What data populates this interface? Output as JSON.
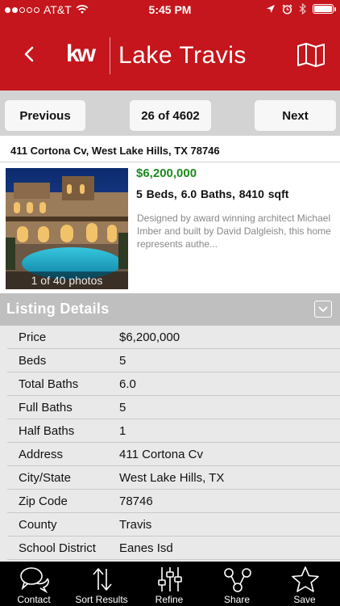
{
  "status_bar": {
    "carrier": "AT&T",
    "time": "5:45 PM"
  },
  "nav": {
    "logo": "kw",
    "title": "Lake Travis"
  },
  "pager": {
    "previous_label": "Previous",
    "position": "26 of 4602",
    "next_label": "Next"
  },
  "listing": {
    "address": "411 Cortona Cv, West Lake Hills, TX 78746",
    "price": "$6,200,000",
    "specs": "5 Beds,  6.0 Baths,  8410 sqft",
    "description": "Designed by award winning architect Michael Imber and built by David Dalgleish, this home represents authe...",
    "photo_caption": "1 of 40 photos"
  },
  "details": {
    "header": "Listing Details",
    "rows": [
      {
        "label": "Price",
        "value": "$6,200,000"
      },
      {
        "label": "Beds",
        "value": "5"
      },
      {
        "label": "Total Baths",
        "value": "6.0"
      },
      {
        "label": "Full Baths",
        "value": "5"
      },
      {
        "label": "Half Baths",
        "value": "1"
      },
      {
        "label": "Address",
        "value": "411 Cortona Cv"
      },
      {
        "label": "City/State",
        "value": "West Lake Hills, TX"
      },
      {
        "label": "Zip Code",
        "value": "78746"
      },
      {
        "label": "County",
        "value": "Travis"
      },
      {
        "label": "School District",
        "value": "Eanes Isd"
      }
    ]
  },
  "tabs": [
    {
      "label": "Contact",
      "icon": "chat-bubbles-icon"
    },
    {
      "label": "Sort Results",
      "icon": "sort-arrows-icon"
    },
    {
      "label": "Refine",
      "icon": "sliders-icon"
    },
    {
      "label": "Share",
      "icon": "share-icon"
    },
    {
      "label": "Save",
      "icon": "star-icon"
    }
  ],
  "colors": {
    "brand_red": "#c4161c",
    "price_green": "#1d8a1d",
    "tab_bar": "#000000",
    "section_header": "#bfbfbf"
  }
}
